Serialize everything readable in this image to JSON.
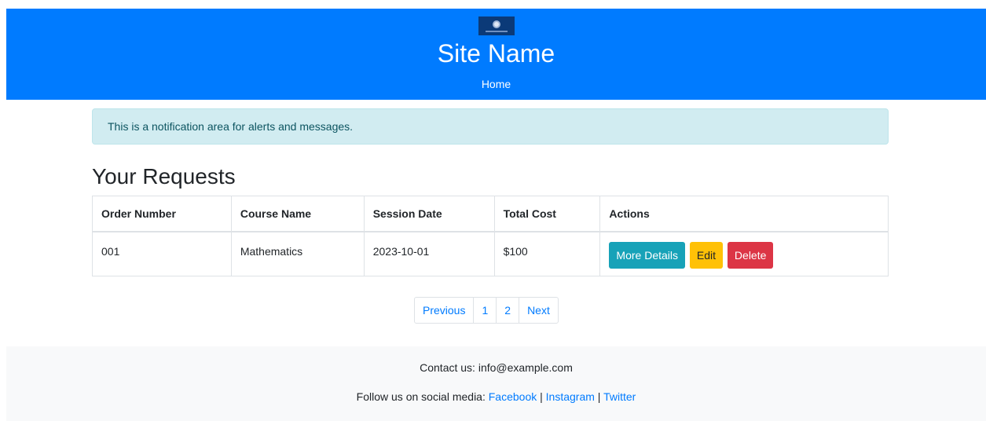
{
  "header": {
    "site_name": "Site Name",
    "nav": {
      "home": "Home"
    },
    "color": "#007bff"
  },
  "alert": {
    "text": "This is a notification area for alerts and messages."
  },
  "requests": {
    "title": "Your Requests",
    "columns": [
      "Order Number",
      "Course Name",
      "Session Date",
      "Total Cost",
      "Actions"
    ],
    "rows": [
      {
        "order_number": "001",
        "course_name": "Mathematics",
        "session_date": "2023-10-01",
        "total_cost": "$100",
        "actions": {
          "details": "More Details",
          "edit": "Edit",
          "delete": "Delete"
        }
      }
    ]
  },
  "pagination": {
    "previous": "Previous",
    "pages": [
      "1",
      "2"
    ],
    "next": "Next"
  },
  "footer": {
    "contact": "Contact us: info@example.com",
    "social_prefix": "Follow us on social media:",
    "social_links": [
      "Facebook",
      "Instagram",
      "Twitter"
    ],
    "separator": "|"
  },
  "colors": {
    "info": "#17a2b8",
    "warning": "#ffc107",
    "danger": "#dc3545",
    "alert_bg": "#d1ecf1"
  }
}
